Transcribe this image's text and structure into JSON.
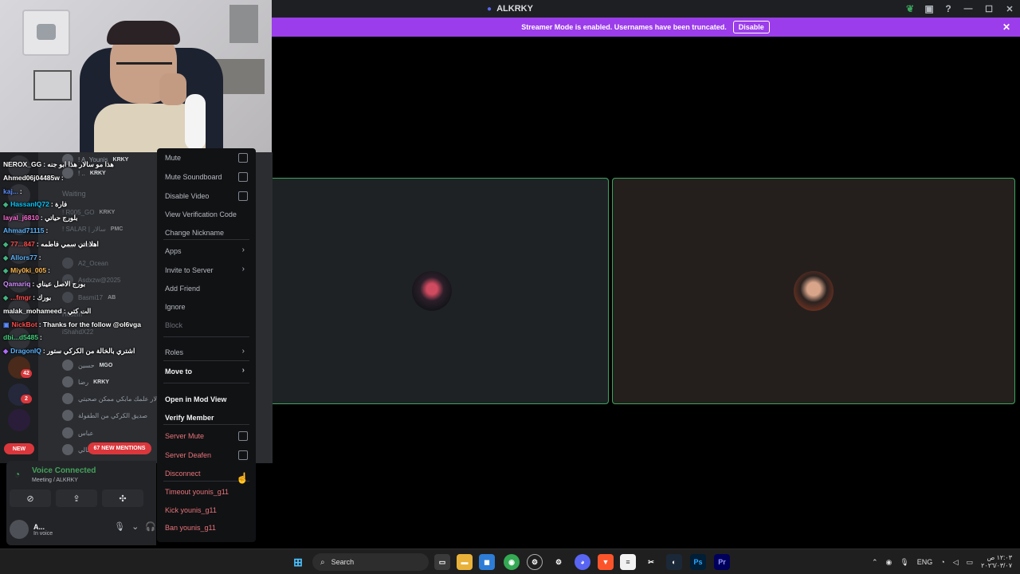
{
  "window": {
    "title": "ALKRKY",
    "icons": [
      "leaf-icon",
      "screen-icon",
      "help-icon"
    ],
    "controls": [
      "minimize-icon",
      "maximize-icon",
      "close-icon"
    ]
  },
  "notice": {
    "text": "Streamer Mode is enabled. Usernames have been truncated.",
    "button": "Disable"
  },
  "channel_members": [
    {
      "name": "! A_Younis",
      "tag": "KRKY"
    },
    {
      "name": "! ..",
      "tag": "KRKY"
    },
    {
      "name": "Waiting",
      "tag": ""
    },
    {
      "name": "! R005_GO",
      "tag": "KRKY"
    },
    {
      "name": "! SALAR | سالار",
      "tag": "PMC"
    },
    {
      "name": "اسعد",
      "tag": "KRKY"
    },
    {
      "name": "A2_Ocean",
      "tag": ""
    },
    {
      "name": "Asdxzw@2025",
      "tag": ""
    },
    {
      "name": "Basmi17",
      "tag": "AB"
    },
    {
      "name": "Hosein",
      "tag": ""
    },
    {
      "name": "iShahdX22",
      "tag": ""
    },
    {
      "name": "حسين",
      "tag": "MGO"
    },
    {
      "name": "رضا",
      "tag": "KRKY"
    },
    {
      "name": "سالار علمك مابكي ممكن صحبتي",
      "tag": ""
    },
    {
      "name": "صديق الكركي من الطفولة",
      "tag": ""
    },
    {
      "name": "عباس",
      "tag": ""
    },
    {
      "name": "غالي",
      "tag": ""
    }
  ],
  "chat": [
    {
      "user": "NEROX_GG",
      "msg": ": هذا مو سالار هذا ابو جنه",
      "color": "#ffffff"
    },
    {
      "user": "Ahmed06j04485w",
      "msg": ":",
      "color": "#ffffff"
    },
    {
      "user": "kaj...",
      "msg": ":",
      "color": "#5b8cff"
    },
    {
      "user": "HassanIQ72",
      "msg": ": فارة",
      "color": "#00c8ff"
    },
    {
      "user": "layal_j6810",
      "msg": ": بلورج حياتي",
      "color": "#ff6bd5"
    },
    {
      "user": "Ahmad71115",
      "msg": ":",
      "color": "#5bb3ff"
    },
    {
      "user": "77...847",
      "msg": ": اهلا اني سمي فاطمه",
      "color": "#ff4d4d"
    },
    {
      "user": "Allors77",
      "msg": ":",
      "color": "#5bb3ff"
    },
    {
      "user": "Miy0ki_005",
      "msg": ":",
      "color": "#ffb84d"
    },
    {
      "user": "Qamariq",
      "msg": ": بورج الاصل عيناي",
      "color": "#d28cff"
    },
    {
      "user": "...fmgr",
      "msg": ": بورك",
      "color": "#ff4d4d"
    },
    {
      "user": "malak_mohameed",
      "msg": ": الت كتي",
      "color": "#ffffff"
    },
    {
      "user": "NickBot",
      "msg": ": Thanks for the follow @ol6vga",
      "color": "#ff4d4d"
    },
    {
      "user": "dbi...d5485",
      "msg": ":",
      "color": "#43d17a"
    },
    {
      "user": "DragonIQ",
      "msg": ": اشتري بالخالة من الكركي ستور",
      "color": "#5bb3ff"
    }
  ],
  "rail": {
    "badges": [
      "42",
      "2"
    ]
  },
  "new_badge": "NEW",
  "mentions": "67 NEW MENTIONS",
  "voice": {
    "status": "Voice Connected",
    "channel": "Meeting / ALKRKY",
    "user_name": "A...",
    "user_status": "In voice"
  },
  "context_menu": {
    "items": [
      {
        "label": "Mute",
        "style": "normal",
        "control": "checkbox"
      },
      {
        "label": "Mute Soundboard",
        "style": "normal",
        "control": "checkbox"
      },
      {
        "label": "Disable Video",
        "style": "normal",
        "control": "checkbox"
      },
      {
        "label": "View Verification Code",
        "style": "normal",
        "control": ""
      },
      {
        "label": "Change Nickname",
        "style": "normal",
        "control": ""
      },
      {
        "label": "Apps",
        "style": "normal",
        "control": "arrow"
      },
      {
        "label": "Invite to Server",
        "style": "normal",
        "control": "arrow"
      },
      {
        "label": "Add Friend",
        "style": "normal",
        "control": ""
      },
      {
        "label": "Ignore",
        "style": "normal",
        "control": ""
      },
      {
        "label": "Block",
        "style": "muted",
        "control": ""
      },
      {
        "label": "Roles",
        "style": "normal",
        "control": "arrow"
      },
      {
        "label": "Move to",
        "style": "bold",
        "control": "arrow"
      },
      {
        "label": "Open in Mod View",
        "style": "bold",
        "control": ""
      },
      {
        "label": "Verify Member",
        "style": "bold",
        "control": ""
      },
      {
        "label": "Server Mute",
        "style": "red",
        "control": "checkbox"
      },
      {
        "label": "Server Deafen",
        "style": "red",
        "control": "checkbox"
      },
      {
        "label": "Disconnect",
        "style": "red",
        "control": ""
      },
      {
        "label": "Timeout younis_g11",
        "style": "red",
        "control": ""
      },
      {
        "label": "Kick younis_g11",
        "style": "red",
        "control": ""
      },
      {
        "label": "Ban younis_g11",
        "style": "red",
        "control": ""
      }
    ]
  },
  "taskbar": {
    "search": "Search",
    "apps": [
      "windows-start-icon",
      "file-explorer-icon",
      "microsoft-store-icon",
      "chrome-icon",
      "steam-icon",
      "discord-icon",
      "brave-icon",
      "notepad-icon",
      "capcut-icon",
      "steam-icon",
      "photoshop-icon",
      "premiere-icon"
    ],
    "photoshop": "Ps",
    "premiere": "Pr",
    "lang": "ENG",
    "time": "١٢:٠٣ ص",
    "date": "٢٠٢٦/٠٣/٠٧"
  },
  "colors": {
    "accent": "#5865f2",
    "notice_bg": "#9b3dea",
    "speaking_border": "#3ba55d",
    "danger": "#da373c"
  }
}
